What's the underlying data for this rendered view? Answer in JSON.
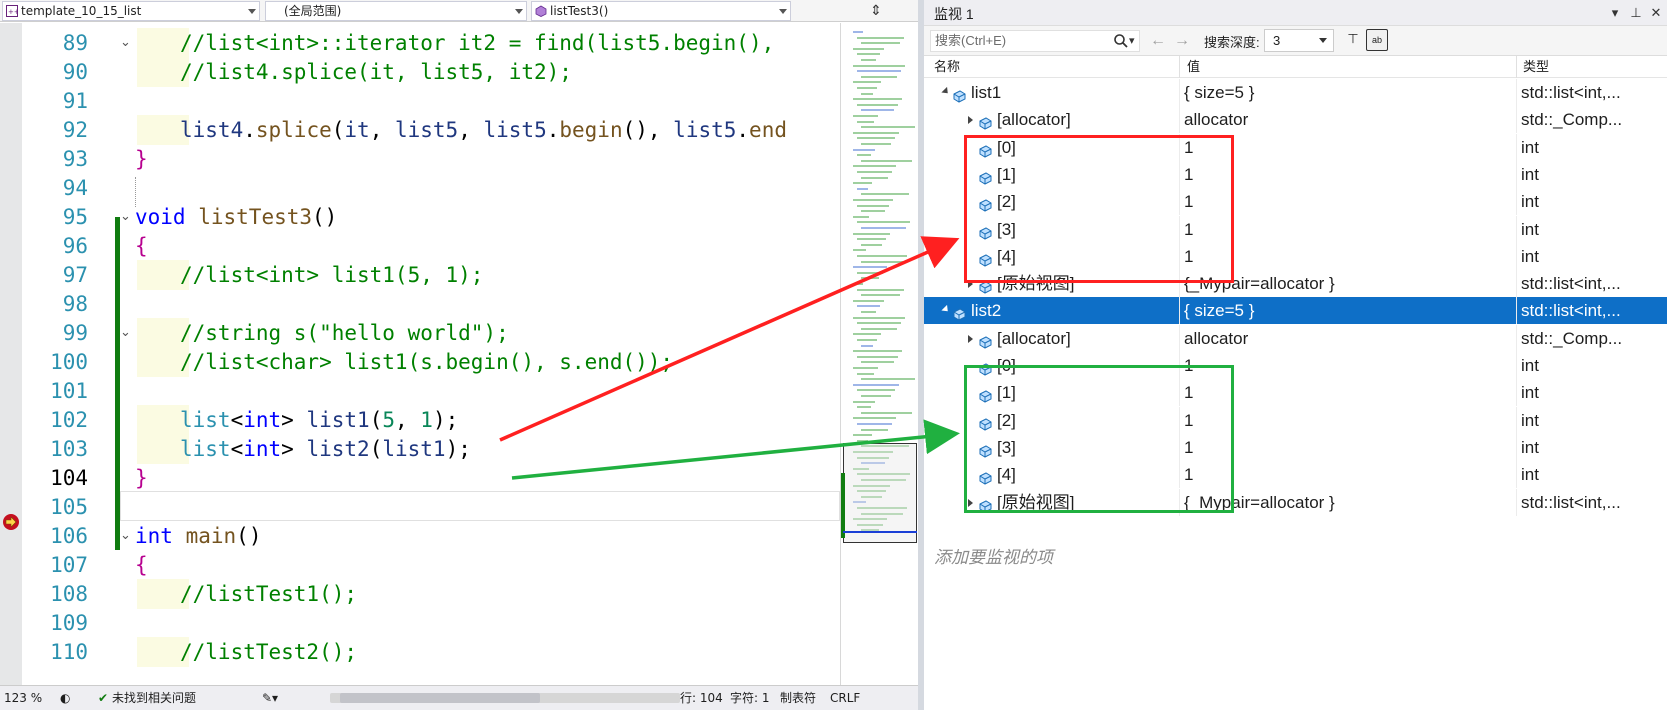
{
  "editor": {
    "nav": {
      "project": "template_10_15_list",
      "scope": "(全局范围)",
      "function": "listTest3()"
    },
    "lines": [
      {
        "num": "89",
        "text": "//list<int>::iterator it2 = find(list5.begin(),"
      },
      {
        "num": "90",
        "text": "//list4.splice(it, list5, it2);"
      },
      {
        "num": "91",
        "text": ""
      },
      {
        "num": "92",
        "text": "list4.splice(it, list5, list5.begin(), list5.end"
      },
      {
        "num": "93",
        "text": "}"
      },
      {
        "num": "94",
        "text": ""
      },
      {
        "num": "95",
        "text": "void listTest3()"
      },
      {
        "num": "96",
        "text": "{"
      },
      {
        "num": "97",
        "text": "//list<int> list1(5, 1);"
      },
      {
        "num": "98",
        "text": ""
      },
      {
        "num": "99",
        "text": "//string s(\"hello world\");"
      },
      {
        "num": "100",
        "text": "//list<char> list1(s.begin(), s.end());"
      },
      {
        "num": "101",
        "text": ""
      },
      {
        "num": "102",
        "text": "list<int> list1(5, 1);"
      },
      {
        "num": "103",
        "text": "list<int> list2(list1);"
      },
      {
        "num": "104",
        "text": "}"
      },
      {
        "num": "105",
        "text": ""
      },
      {
        "num": "106",
        "text": "int main()"
      },
      {
        "num": "107",
        "text": "{"
      },
      {
        "num": "108",
        "text": "//listTest1();"
      },
      {
        "num": "109",
        "text": ""
      },
      {
        "num": "110",
        "text": "//listTest2();"
      }
    ],
    "status": {
      "zoom": "123 %",
      "issues": "未找到相关问题",
      "line": "行: 104",
      "col": "字符: 1",
      "indent": "制表符",
      "eol": "CRLF"
    }
  },
  "watch": {
    "title": "监视 1",
    "search_placeholder": "搜索(Ctrl+E)",
    "depth_label": "搜索深度:",
    "depth_value": "3",
    "columns": {
      "name": "名称",
      "value": "值",
      "type": "类型"
    },
    "rows": [
      {
        "name": "list1",
        "value": "{ size=5 }",
        "type": "std::list<int,...",
        "level": 0,
        "expander": "expanded",
        "selected": false
      },
      {
        "name": "[allocator]",
        "value": "allocator",
        "type": "std::_Comp...",
        "level": 1,
        "expander": "collapsed",
        "selected": false
      },
      {
        "name": "[0]",
        "value": "1",
        "type": "int",
        "level": 1,
        "expander": "none",
        "selected": false
      },
      {
        "name": "[1]",
        "value": "1",
        "type": "int",
        "level": 1,
        "expander": "none",
        "selected": false
      },
      {
        "name": "[2]",
        "value": "1",
        "type": "int",
        "level": 1,
        "expander": "none",
        "selected": false
      },
      {
        "name": "[3]",
        "value": "1",
        "type": "int",
        "level": 1,
        "expander": "none",
        "selected": false
      },
      {
        "name": "[4]",
        "value": "1",
        "type": "int",
        "level": 1,
        "expander": "none",
        "selected": false
      },
      {
        "name": "[原始视图]",
        "value": "{_Mypair=allocator }",
        "type": "std::list<int,...",
        "level": 1,
        "expander": "collapsed",
        "selected": false
      },
      {
        "name": "list2",
        "value": "{ size=5 }",
        "type": "std::list<int,...",
        "level": 0,
        "expander": "expanded",
        "selected": true
      },
      {
        "name": "[allocator]",
        "value": "allocator",
        "type": "std::_Comp...",
        "level": 1,
        "expander": "collapsed",
        "selected": false
      },
      {
        "name": "[0]",
        "value": "1",
        "type": "int",
        "level": 1,
        "expander": "none",
        "selected": false
      },
      {
        "name": "[1]",
        "value": "1",
        "type": "int",
        "level": 1,
        "expander": "none",
        "selected": false
      },
      {
        "name": "[2]",
        "value": "1",
        "type": "int",
        "level": 1,
        "expander": "none",
        "selected": false
      },
      {
        "name": "[3]",
        "value": "1",
        "type": "int",
        "level": 1,
        "expander": "none",
        "selected": false
      },
      {
        "name": "[4]",
        "value": "1",
        "type": "int",
        "level": 1,
        "expander": "none",
        "selected": false
      },
      {
        "name": "[原始视图]",
        "value": "{_Mypair=allocator }",
        "type": "std::list<int,...",
        "level": 1,
        "expander": "collapsed",
        "selected": false
      }
    ],
    "add_watch": "添加要监视的项"
  },
  "annotations": {
    "red": "#ff2020",
    "green": "#20b040"
  },
  "colors": {
    "selection": "#0e6fc7",
    "comment": "#008000",
    "keyword": "#0000ff",
    "type": "#2b91af",
    "change_bar": "#107c10"
  }
}
